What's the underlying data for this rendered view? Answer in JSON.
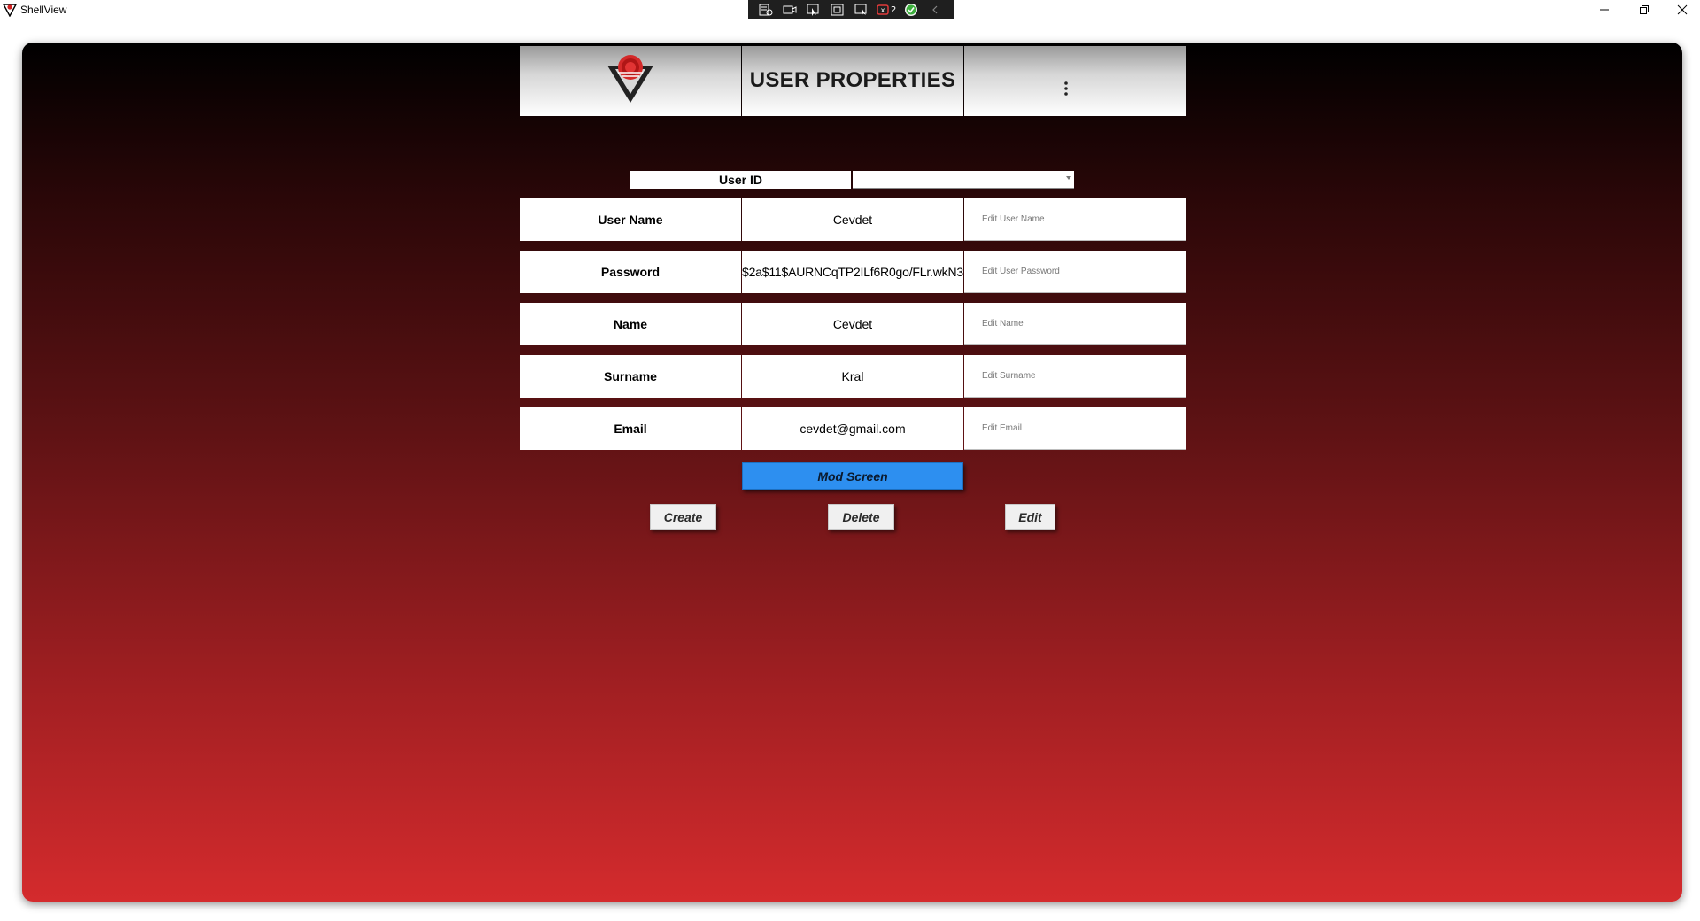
{
  "window": {
    "title": "ShellView"
  },
  "debug_toolbar": {
    "binding_count": "2",
    "icons": [
      "live-visual-tree-icon",
      "record-icon",
      "select-element-icon",
      "display-layout-adorners-icon",
      "track-focus-icon",
      "binding-failures-icon",
      "hot-reload-ok-icon",
      "collapse-icon"
    ]
  },
  "header": {
    "title": "USER PROPERTIES",
    "logo": "red-triangle-logo",
    "menu_icon": "more-vertical-icon"
  },
  "user_id": {
    "label": "User ID",
    "selected_value": ""
  },
  "fields": [
    {
      "label": "User Name",
      "value": "Cevdet",
      "placeholder": "Edit User Name"
    },
    {
      "label": "Password",
      "value": "$2a$11$AURNCqTP2ILf6R0go/FLr.wkN3",
      "placeholder": "Edit User Password"
    },
    {
      "label": "Name",
      "value": "Cevdet",
      "placeholder": "Edit Name"
    },
    {
      "label": "Surname",
      "value": "Kral",
      "placeholder": "Edit Surname"
    },
    {
      "label": "Email",
      "value": "cevdet@gmail.com",
      "placeholder": "Edit Email"
    }
  ],
  "buttons": {
    "mod_screen": "Mod Screen",
    "create": "Create",
    "delete": "Delete",
    "edit": "Edit"
  },
  "colors": {
    "gradient_top": "#000000",
    "gradient_bottom": "#d42b2d",
    "mod_button": "#2d8ff0"
  }
}
